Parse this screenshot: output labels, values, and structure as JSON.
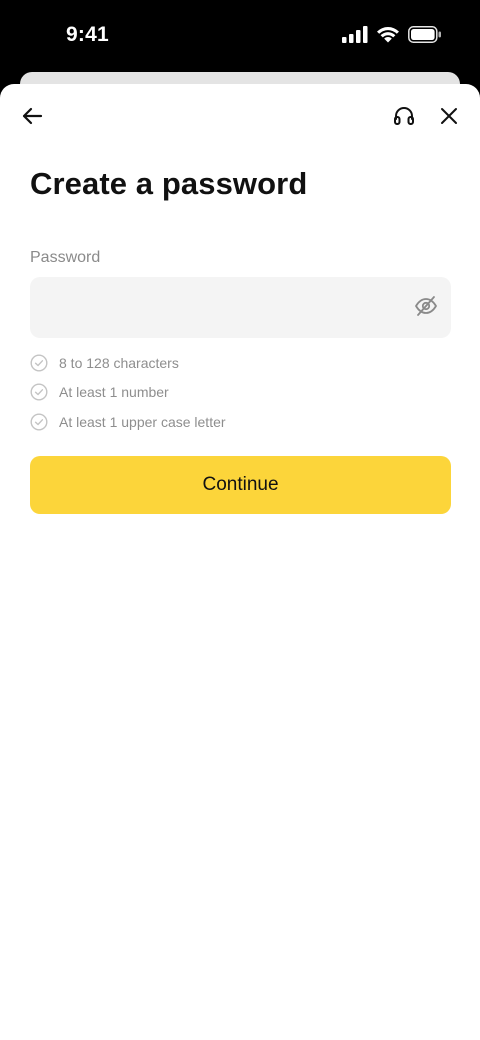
{
  "status_bar": {
    "time": "9:41",
    "icons": [
      "cellular-signal-icon",
      "wifi-icon",
      "battery-icon"
    ]
  },
  "header": {
    "back_icon": "arrow-left-icon",
    "support_icon": "headset-icon",
    "close_icon": "close-icon"
  },
  "page": {
    "title": "Create a password"
  },
  "password_field": {
    "label": "Password",
    "value": "",
    "placeholder": "",
    "toggle_icon": "eye-off-icon"
  },
  "requirements": [
    {
      "text": "8 to 128 characters",
      "icon": "check-circle-icon"
    },
    {
      "text": "At least 1 number",
      "icon": "check-circle-icon"
    },
    {
      "text": "At least 1 upper case letter",
      "icon": "check-circle-icon"
    }
  ],
  "continue_button": {
    "label": "Continue"
  },
  "colors": {
    "accent": "#fcd53a",
    "field_background": "#f4f4f4",
    "muted_text": "#8e8e8e",
    "text": "#111111"
  }
}
